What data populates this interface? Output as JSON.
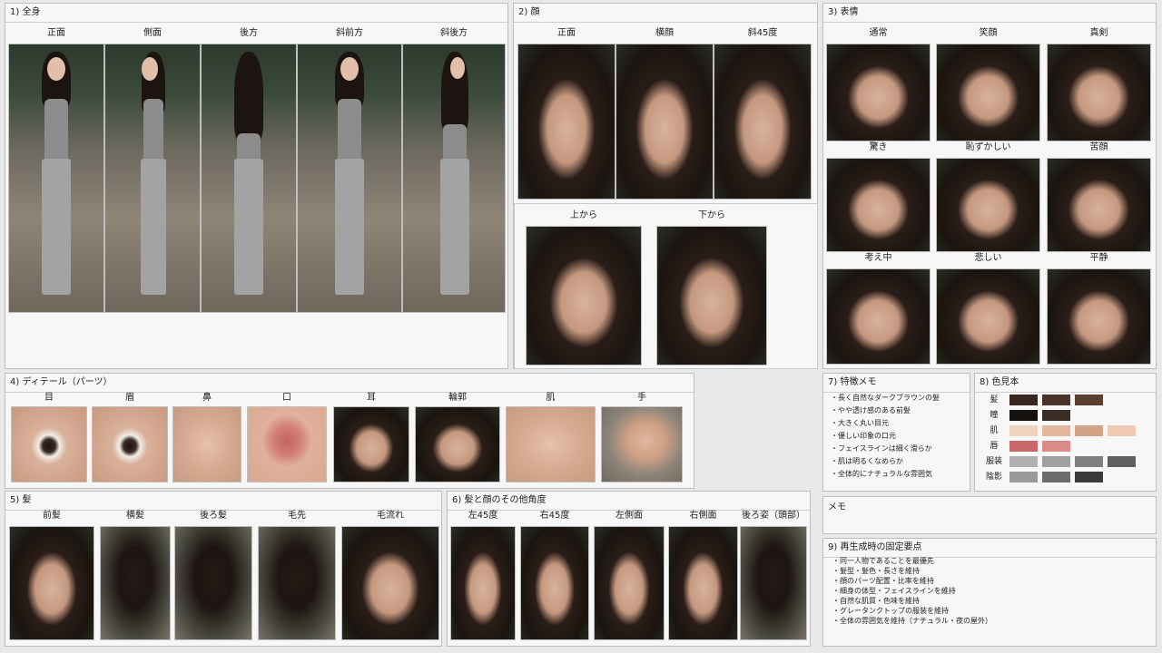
{
  "panels": {
    "p1": {
      "title": "1) 全身",
      "labels": [
        "正面",
        "側面",
        "後方",
        "斜前方",
        "斜後方"
      ]
    },
    "p2": {
      "title": "2) 顔",
      "labels": [
        "正面",
        "横顔",
        "斜45度"
      ],
      "labels2": [
        "上から",
        "下から"
      ]
    },
    "p3": {
      "title": "3) 表情",
      "labels": [
        "通常",
        "笑顔",
        "真剣",
        "驚き",
        "恥ずかしい",
        "苦顔",
        "考え中",
        "悲しい",
        "平静"
      ]
    },
    "p4": {
      "title": "4) ディテール（パーツ）",
      "labels": [
        "目",
        "眉",
        "鼻",
        "口",
        "耳",
        "輪郭",
        "肌",
        "手"
      ]
    },
    "p5": {
      "title": "5) 髪",
      "labels": [
        "前髪",
        "横髪",
        "後ろ髪",
        "毛先",
        "毛流れ"
      ]
    },
    "p6": {
      "title": "6) 髪と顔のその他角度",
      "labels": [
        "左45度",
        "右45度",
        "左側面",
        "右側面",
        "後ろ姿（頭部）"
      ]
    },
    "p7": {
      "title": "7) 特徴メモ",
      "notes": [
        "・長く自然なダークブラウンの髪",
        "・やや透け感のある前髪",
        "・大きく丸い目元",
        "・優しい印象の口元",
        "・フェイスラインは細く滑らか",
        "・肌は明るくなめらか",
        "・全体的にナチュラルな雰囲気"
      ]
    },
    "p8": {
      "title": "8) 色見本",
      "rows": [
        {
          "label": "髪",
          "colors": [
            "#3a2620",
            "#4a342a",
            "#5a3e30"
          ]
        },
        {
          "label": "瞳",
          "colors": [
            "#15110f",
            "#3b2c26"
          ]
        },
        {
          "label": "肌",
          "colors": [
            "#f1d2bf",
            "#e4b89c",
            "#d1a486",
            "#efc9b3"
          ]
        },
        {
          "label": "唇",
          "colors": [
            "#c9686a",
            "#d98b87"
          ]
        },
        {
          "label": "服装",
          "colors": [
            "#b0b0b0",
            "#a0a0a0",
            "#7f7f7f",
            "#5f5f5f"
          ]
        },
        {
          "label": "陰影",
          "colors": [
            "#9a9a9a",
            "#6b6b6b",
            "#3a3a3a"
          ]
        }
      ]
    },
    "memo": {
      "title": "メモ"
    },
    "p9": {
      "title": "9) 再生成時の固定要点",
      "points": [
        "・同一人物であることを最優先",
        "・髪型・髪色・長さを維持",
        "・顔のパーツ配置・比率を維持",
        "・細身の体型・フェイスラインを維持",
        "・自然な肌質・色味を維持",
        "・グレータンクトップの服装を維持",
        "・全体の雰囲気を維持（ナチュラル・夜の屋外）"
      ]
    }
  }
}
